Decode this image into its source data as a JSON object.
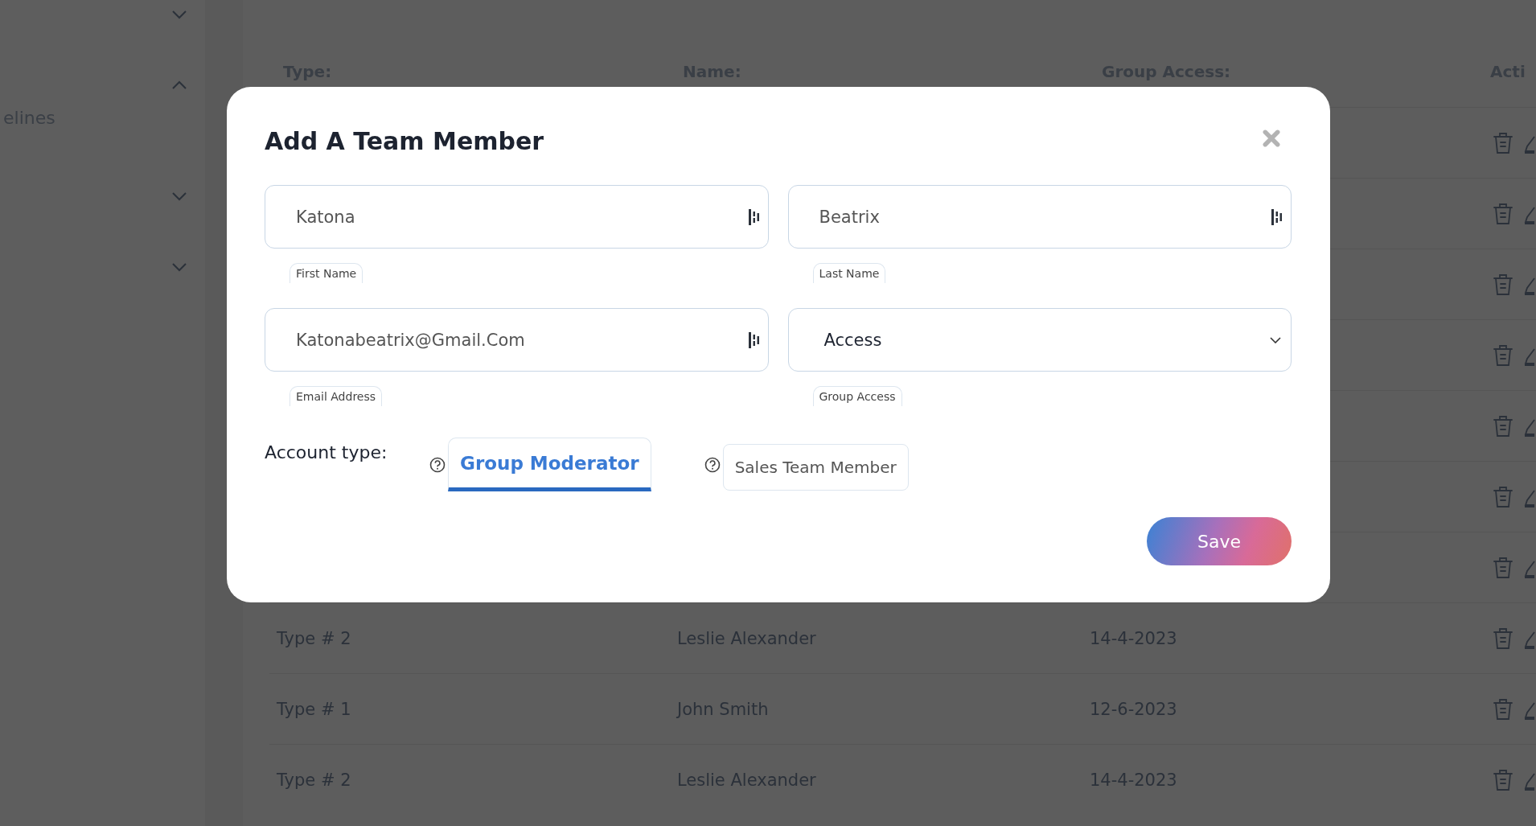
{
  "sidebar": {
    "items": [
      {
        "expanded": false
      },
      {
        "expanded": true,
        "children": [
          {
            "label": "elines"
          }
        ]
      },
      {
        "expanded": false
      },
      {
        "expanded": false
      }
    ]
  },
  "table": {
    "columns": [
      "Type:",
      "Name:",
      "Group Access:",
      "Acti"
    ],
    "rows": [
      {
        "kind": "covered"
      },
      {
        "kind": "covered"
      },
      {
        "kind": "covered"
      },
      {
        "kind": "covered"
      },
      {
        "kind": "covered"
      },
      {
        "kind": "covered"
      },
      {
        "kind": "covered"
      },
      {
        "kind": "data",
        "type": "Type # 2",
        "name": "Leslie Alexander",
        "date": "14-4-2023"
      },
      {
        "kind": "data",
        "type": "Type # 1",
        "name": "John Smith",
        "date": "12-6-2023"
      },
      {
        "kind": "data",
        "type": "Type # 2",
        "name": "Leslie Alexander",
        "date": "14-4-2023"
      }
    ]
  },
  "modal": {
    "title": "Add A Team Member",
    "fields": [
      {
        "kind": "text",
        "value": "Katona",
        "label": "First Name"
      },
      {
        "kind": "text",
        "value": "Beatrix",
        "label": "Last Name"
      },
      {
        "kind": "text",
        "value": "Katonabeatrix@Gmail.Com",
        "label": "Email Address"
      },
      {
        "kind": "select",
        "value": "Access",
        "label": "Group Access"
      }
    ],
    "account_type": {
      "label": "Account type:",
      "options": [
        {
          "label": "Group Moderator",
          "selected": true
        },
        {
          "label": "Sales Team Member",
          "selected": false
        }
      ]
    },
    "save": "Save"
  }
}
